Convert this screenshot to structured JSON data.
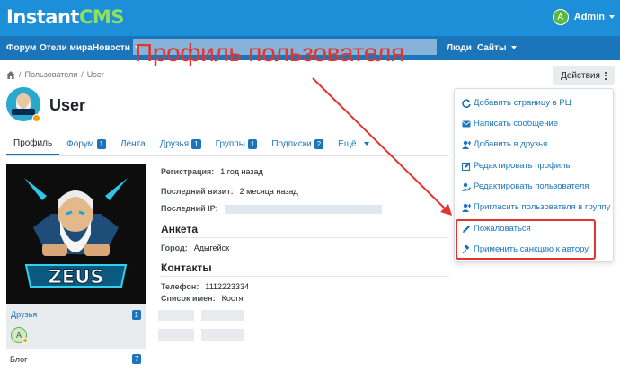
{
  "brand": {
    "logo_main": "Instant",
    "logo_accent": "CMS"
  },
  "user_menu": {
    "avatar_letter": "A",
    "name": "Admin"
  },
  "nav": {
    "items": [
      "Форум",
      "Отели мира",
      "Новости",
      "Люди",
      "Сайты"
    ]
  },
  "annotation": {
    "title": "Профиль пользователя"
  },
  "breadcrumb": {
    "items": [
      "Пользователи",
      "User"
    ]
  },
  "actions": {
    "label": "Действия"
  },
  "profile": {
    "name": "User"
  },
  "tabs": [
    {
      "label": "Профиль",
      "badge": ""
    },
    {
      "label": "Форум",
      "badge": "1"
    },
    {
      "label": "Лента",
      "badge": ""
    },
    {
      "label": "Друзья",
      "badge": "1"
    },
    {
      "label": "Группы",
      "badge": "1"
    },
    {
      "label": "Подписки",
      "badge": "2"
    },
    {
      "label": "Ещё",
      "badge": ""
    }
  ],
  "cover": {
    "text": "ZEUS"
  },
  "friends": {
    "label": "Друзья",
    "count": "1",
    "avatar_letter": "A"
  },
  "blog": {
    "label": "Блог",
    "count": "7"
  },
  "info": {
    "registration_label": "Регистрация:",
    "registration_value": "1 год назад",
    "last_visit_label": "Последний визит:",
    "last_visit_value": "2 месяца назад",
    "last_ip_label": "Последний IP:"
  },
  "anketa": {
    "title": "Анкета",
    "city_label": "Город:",
    "city_value": "Адыгейск"
  },
  "contacts": {
    "title": "Контакты",
    "phone_label": "Телефон:",
    "phone_value": "1112223334",
    "names_label": "Список имен:",
    "names_value": "Костя"
  },
  "dropdown": {
    "items": [
      "Добавить страницу в РЦ",
      "Написать сообщение",
      "Добавить в друзья",
      "Редактировать профиль",
      "Редактировать пользователя",
      "Пригласить пользователя в группу",
      "Пожаловаться",
      "Применить санкцию к автору"
    ]
  },
  "colors": {
    "header_bg": "#1d8fd8",
    "nav_bg": "#1b75bb",
    "logo_accent": "#8fe05d",
    "link": "#1b75bb",
    "annotation_red": "#e3342f",
    "status_dot": "#f39c12"
  }
}
